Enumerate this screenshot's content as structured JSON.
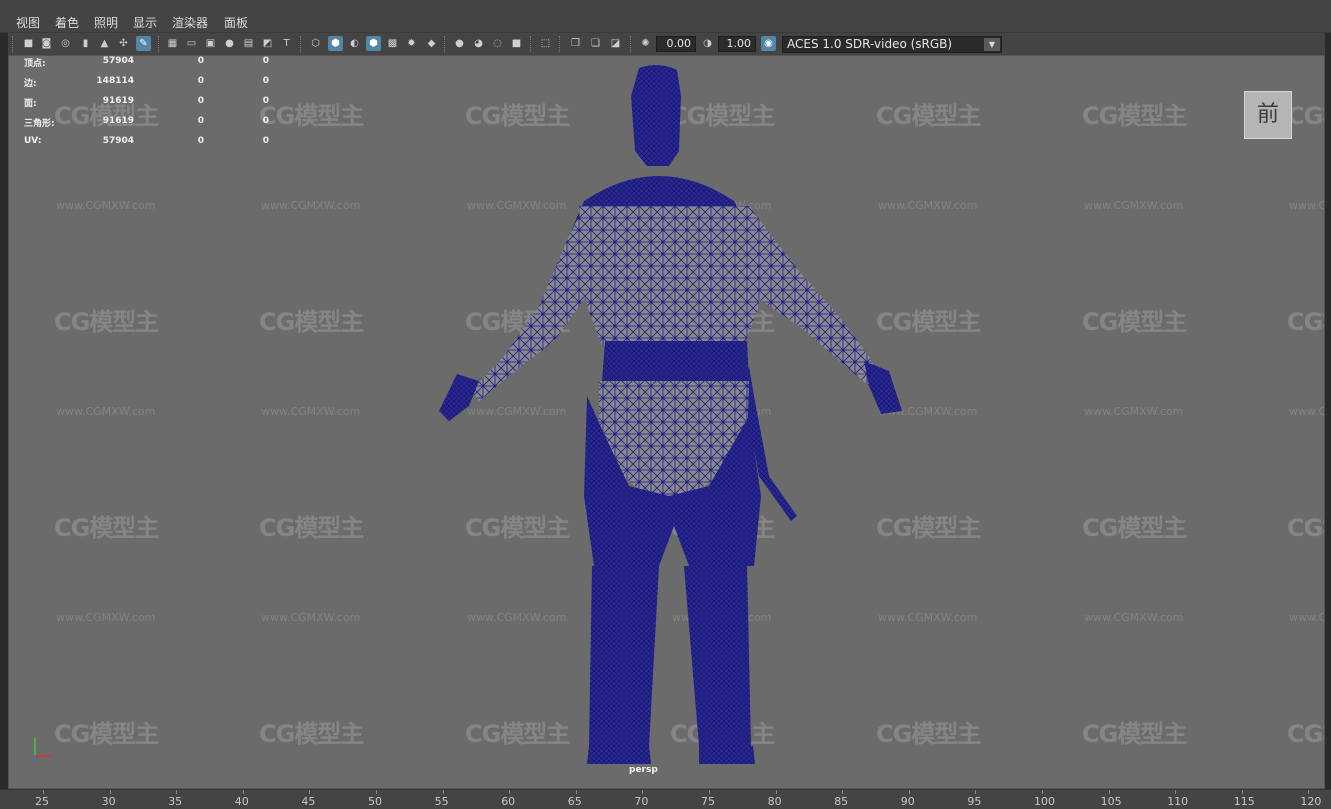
{
  "menu": [
    "视图",
    "着色",
    "照明",
    "显示",
    "渲染器",
    "面板"
  ],
  "toolbar": {
    "field_value_1": "0.00",
    "field_value_2": "1.00",
    "color_space": "ACES 1.0 SDR-video (sRGB)"
  },
  "hud": {
    "rows": [
      {
        "label": "顶点:",
        "v1": "57904",
        "v2": "0",
        "v3": "0"
      },
      {
        "label": "边:",
        "v1": "148114",
        "v2": "0",
        "v3": "0"
      },
      {
        "label": "面:",
        "v1": "91619",
        "v2": "0",
        "v3": "0"
      },
      {
        "label": "三角形:",
        "v1": "91619",
        "v2": "0",
        "v3": "0"
      },
      {
        "label": "UV:",
        "v1": "57904",
        "v2": "0",
        "v3": "0"
      }
    ]
  },
  "view_cube_label": "前",
  "camera_label": "persp",
  "watermark": {
    "logo": "CG模型主",
    "url": "www.CGMXW.com"
  },
  "timeline_ticks": [
    "25",
    "30",
    "35",
    "40",
    "45",
    "50",
    "55",
    "60",
    "65",
    "70",
    "75",
    "80",
    "85",
    "90",
    "95",
    "100",
    "105",
    "110",
    "115",
    "120"
  ],
  "colors": {
    "wireframe": "#1d1a8c",
    "viewport_bg": "#6b6b6b",
    "active_button": "#5285a6"
  }
}
